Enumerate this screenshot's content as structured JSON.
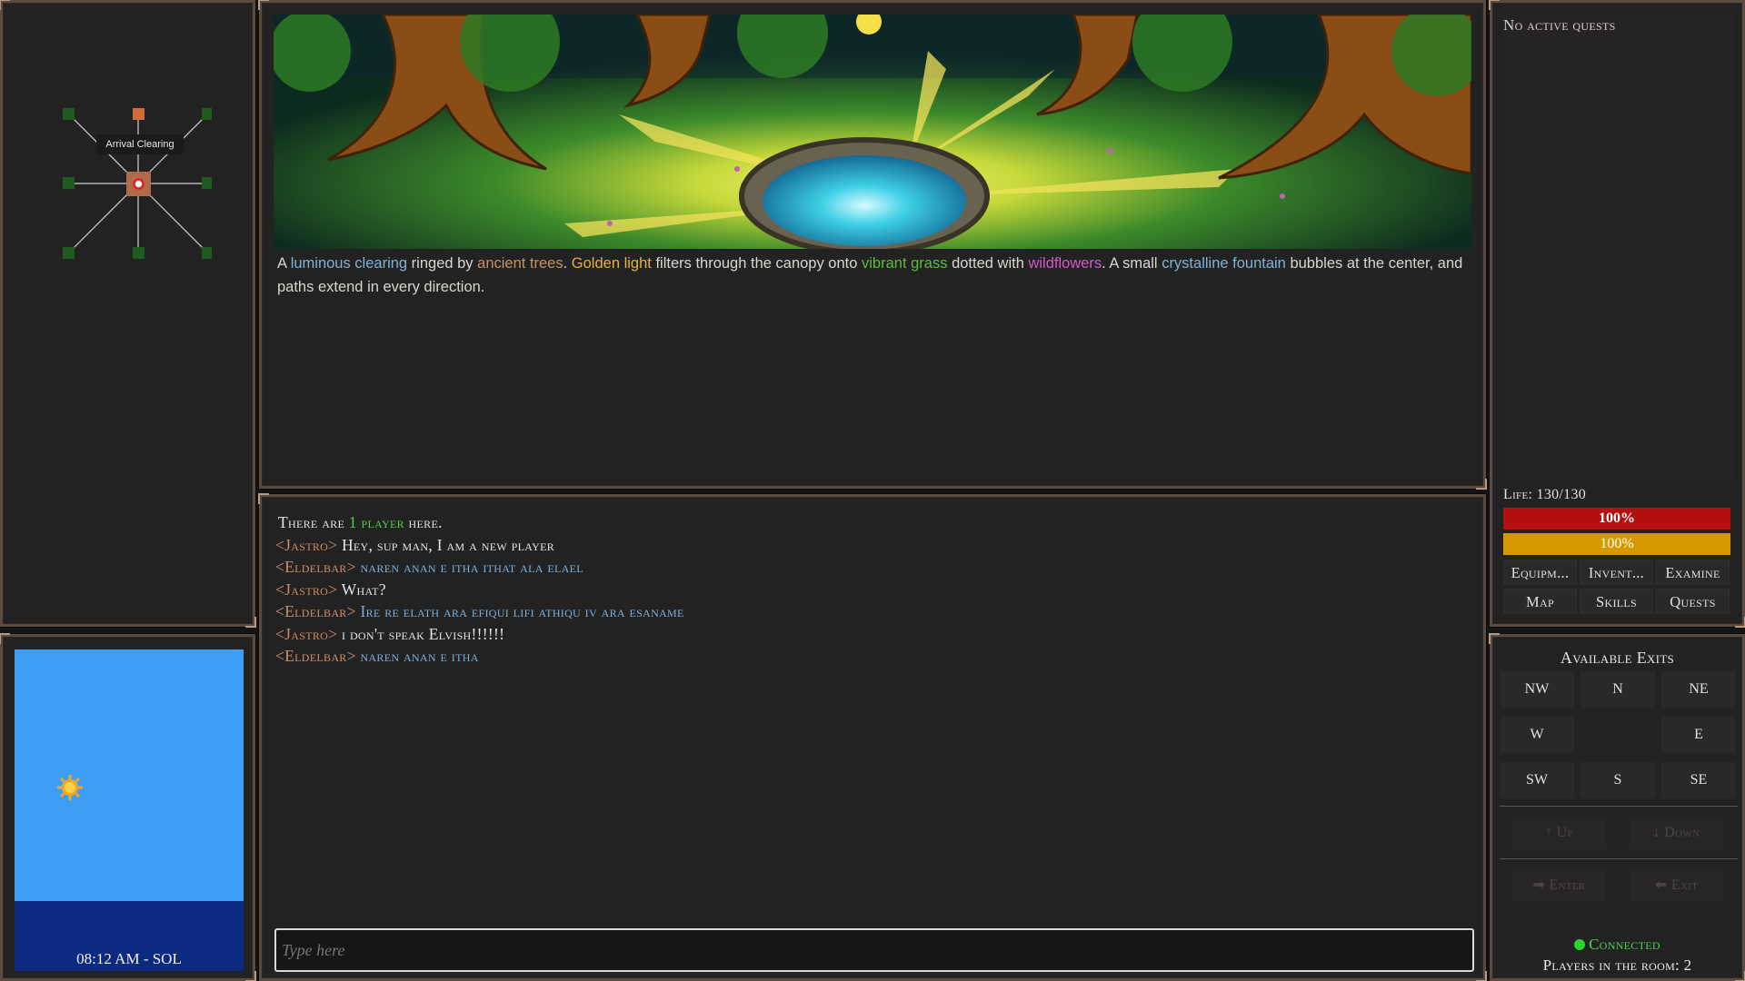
{
  "minimap": {
    "current_room": "Arrival Clearing"
  },
  "clock": {
    "time": "08:12 AM - SOL"
  },
  "room": {
    "description": [
      {
        "text": "A ",
        "style": "plain"
      },
      {
        "text": "luminous clearing",
        "style": "blue"
      },
      {
        "text": " ringed by ",
        "style": "plain"
      },
      {
        "text": "ancient trees",
        "style": "tan"
      },
      {
        "text": ". ",
        "style": "plain"
      },
      {
        "text": "Golden light",
        "style": "gold"
      },
      {
        "text": " filters through the canopy onto ",
        "style": "plain"
      },
      {
        "text": "vibrant grass",
        "style": "green"
      },
      {
        "text": " dotted with ",
        "style": "plain"
      },
      {
        "text": "wildflowers",
        "style": "pink"
      },
      {
        "text": ". A small ",
        "style": "plain"
      },
      {
        "text": "crystalline fountain",
        "style": "cyan"
      },
      {
        "text": " bubbles at the center, and paths extend in every direction.",
        "style": "plain"
      }
    ]
  },
  "chat": {
    "presence": {
      "prefix": "There are ",
      "highlight": "1 player",
      "suffix": " here."
    },
    "messages": [
      {
        "speaker": "<Jastro>",
        "text": "Hey, sup man, I am a new player",
        "lang": "plain"
      },
      {
        "speaker": "<Eldelbar>",
        "text": "naren anan e itha ithat ala elael",
        "lang": "elvish"
      },
      {
        "speaker": "<Jastro>",
        "text": "What?",
        "lang": "plain"
      },
      {
        "speaker": "<Eldelbar>",
        "text": "Ire re elath ara efiqui lifi athiqu iv ara esaname",
        "lang": "elvish"
      },
      {
        "speaker": "<Jastro>",
        "text": "i don't speak Elvish!!!!!!",
        "lang": "plain"
      },
      {
        "speaker": "<Eldelbar>",
        "text": "naren anan e itha",
        "lang": "elvish"
      }
    ],
    "input_placeholder": "Type here"
  },
  "status": {
    "quests_text": "No active quests",
    "life_label": "Life: 130/130",
    "life_percent": "100%",
    "life_fraction": 1.0,
    "stamina_percent": "100%",
    "stamina_fraction": 1.0,
    "commands": [
      "Equipm...",
      "Invent...",
      "Examine",
      "Map",
      "Skills",
      "Quests"
    ]
  },
  "exits": {
    "title": "Available Exits",
    "grid": [
      "NW",
      "N",
      "NE",
      "W",
      "",
      "E",
      "SW",
      "S",
      "SE"
    ],
    "up": "↑ Up",
    "down": "↓ Down",
    "enter": "➡ Enter",
    "exit": "⬅ Exit",
    "connection": "Connected",
    "players_in_room": "Players in the room: 2"
  },
  "colors": {
    "life_bar": "#b51010",
    "stamina_bar": "#d69a00",
    "connected": "#47d447",
    "sky": "#3d9ef5",
    "ground": "#0c2a80"
  }
}
